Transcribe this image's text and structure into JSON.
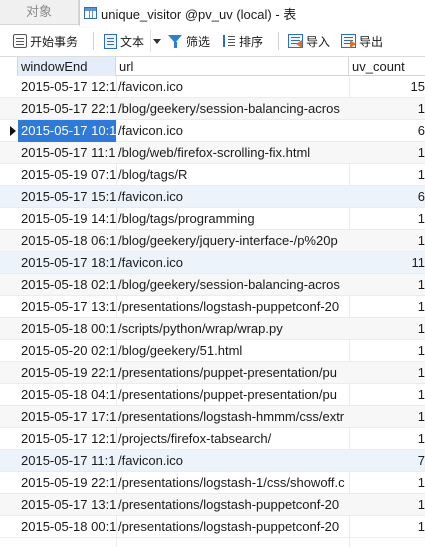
{
  "tabs": {
    "objects_label": "对象",
    "table_label": "unique_visitor @pv_uv (local) - 表"
  },
  "toolbar": {
    "begin_transaction": "开始事务",
    "text": "文本",
    "filter": "筛选",
    "sort": "排序",
    "import": "导入",
    "export": "导出"
  },
  "grid": {
    "columns": [
      "windowEnd",
      "url",
      "uv_count"
    ],
    "rows": [
      [
        "2015-05-17 12:1",
        "/favicon.ico",
        "15"
      ],
      [
        "2015-05-17 22:1",
        "/blog/geekery/session-balancing-acros",
        "1"
      ],
      [
        "2015-05-17 10:1",
        "/favicon.ico",
        "6"
      ],
      [
        "2015-05-17 11:1",
        "/blog/web/firefox-scrolling-fix.html",
        "1"
      ],
      [
        "2015-05-19 07:1",
        "/blog/tags/R",
        "1"
      ],
      [
        "2015-05-17 15:1",
        "/favicon.ico",
        "6"
      ],
      [
        "2015-05-19 14:1",
        "/blog/tags/programming",
        "1"
      ],
      [
        "2015-05-18 06:1",
        "/blog/geekery/jquery-interface-/p%20p",
        "1"
      ],
      [
        "2015-05-17 18:1",
        "/favicon.ico",
        "11"
      ],
      [
        "2015-05-18 02:1",
        "/blog/geekery/session-balancing-acros",
        "1"
      ],
      [
        "2015-05-17 13:1",
        "/presentations/logstash-puppetconf-20",
        "1"
      ],
      [
        "2015-05-18 00:1",
        "/scripts/python/wrap/wrap.py",
        "1"
      ],
      [
        "2015-05-20 02:1",
        "/blog/geekery/51.html",
        "1"
      ],
      [
        "2015-05-19 22:1",
        "/presentations/puppet-presentation/pu",
        "1"
      ],
      [
        "2015-05-18 04:1",
        "/presentations/puppet-presentation/pu",
        "1"
      ],
      [
        "2015-05-17 17:1",
        "/presentations/logstash-hmmm/css/extr",
        "1"
      ],
      [
        "2015-05-17 12:1",
        "/projects/firefox-tabsearch/",
        "1"
      ],
      [
        "2015-05-17 11:1",
        "/favicon.ico",
        "7"
      ],
      [
        "2015-05-19 22:1",
        "/presentations/logstash-1/css/showoff.c",
        "1"
      ],
      [
        "2015-05-17 13:1",
        "/presentations/logstash-puppetconf-20",
        "1"
      ],
      [
        "2015-05-18 00:1",
        "/presentations/logstash-puppetconf-20",
        "1"
      ]
    ]
  }
}
